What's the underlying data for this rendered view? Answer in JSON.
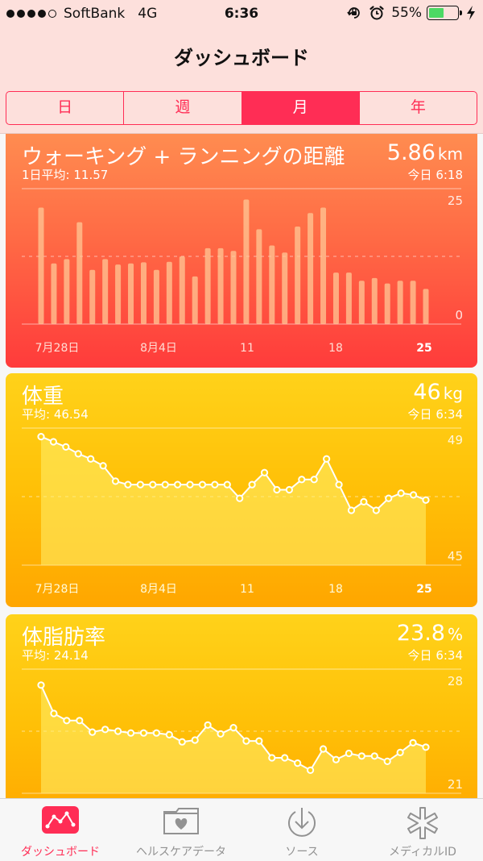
{
  "status_bar": {
    "carrier": "SoftBank",
    "network": "4G",
    "time": "6:36",
    "battery": "55%",
    "battery_level": 0.55,
    "signal_bars": 4
  },
  "nav": {
    "title": "ダッシュボード"
  },
  "segments": [
    {
      "label": "日",
      "active": false
    },
    {
      "label": "週",
      "active": false
    },
    {
      "label": "月",
      "active": true
    },
    {
      "label": "年",
      "active": false
    }
  ],
  "cards": [
    {
      "title": "ウォーキング + ランニングの距離",
      "subtitle": "1日平均: 11.57",
      "value": "5.86",
      "unit": "km",
      "time": "今日 6:18"
    },
    {
      "title": "体重",
      "subtitle": "平均: 46.54",
      "value": "46",
      "unit": "kg",
      "time": "今日 6:34"
    },
    {
      "title": "体脂肪率",
      "subtitle": "平均: 24.14",
      "value": "23.8",
      "unit": "%",
      "time": "今日 6:34"
    }
  ],
  "chart_data": [
    {
      "type": "bar",
      "ylim": [
        0,
        25
      ],
      "y_ticks": [
        "25",
        "0"
      ],
      "x_tick_labels": [
        "7月28日",
        "8月4日",
        "11",
        "18",
        "25"
      ],
      "highlight_tick": "25",
      "values": [
        21.5,
        11.2,
        12,
        18.8,
        10,
        12,
        11,
        11.2,
        11.4,
        10,
        11.5,
        12.5,
        8.8,
        14,
        14,
        13.5,
        23,
        17.5,
        14.5,
        13.2,
        18,
        20.5,
        21.5,
        9.5,
        9.5,
        8,
        8.5,
        7.5,
        8,
        8,
        6.5
      ]
    },
    {
      "type": "line",
      "ylim": [
        45,
        49
      ],
      "y_ticks": [
        "49",
        "45"
      ],
      "x_tick_labels": [
        "7月28日",
        "8月4日",
        "11",
        "18",
        "25"
      ],
      "highlight_tick": "25",
      "values": [
        48.75,
        48.6,
        48.45,
        48.25,
        48.1,
        47.9,
        47.45,
        47.35,
        47.35,
        47.35,
        47.35,
        47.35,
        47.35,
        47.35,
        47.35,
        47.35,
        46.95,
        47.35,
        47.7,
        47.2,
        47.2,
        47.5,
        47.5,
        48.1,
        47.35,
        46.6,
        46.85,
        46.6,
        46.95,
        47.1,
        47.05,
        46.9
      ]
    },
    {
      "type": "line",
      "ylim": [
        21,
        28
      ],
      "y_ticks": [
        "28",
        "21"
      ],
      "x_tick_labels": [],
      "values": [
        27.1,
        25.5,
        25.1,
        25.1,
        24.45,
        24.6,
        24.5,
        24.4,
        24.4,
        24.4,
        24.3,
        23.9,
        24.0,
        24.85,
        24.35,
        24.7,
        23.95,
        23.95,
        23.0,
        23.0,
        22.7,
        22.3,
        23.5,
        22.9,
        23.25,
        23.1,
        23.1,
        22.8,
        23.3,
        23.85,
        23.6
      ]
    }
  ],
  "tabs": [
    {
      "label": "ダッシュボード",
      "icon": "dashboard-chart-icon",
      "active": true
    },
    {
      "label": "ヘルスケアデータ",
      "icon": "health-folder-heart-icon",
      "active": false
    },
    {
      "label": "ソース",
      "icon": "download-sources-icon",
      "active": false
    },
    {
      "label": "メディカルID",
      "icon": "medical-star-icon",
      "active": false
    }
  ]
}
